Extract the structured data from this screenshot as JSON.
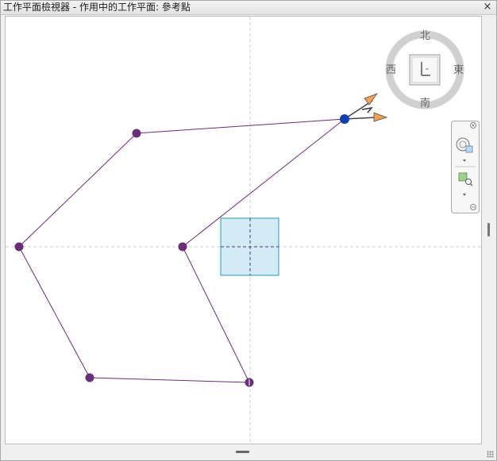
{
  "window": {
    "title": "工作平面檢視器 - 作用中的工作平面: 參考點",
    "close_glyph": "×"
  },
  "viewcube": {
    "north": "北",
    "south": "南",
    "east": "東",
    "west": "西"
  },
  "colors": {
    "curve": "#6a2d7a",
    "point": "#6a2d7a",
    "selected_point": "#1040b0",
    "workplane_fill": "#d3ebf5",
    "workplane_stroke": "#2a9bb0",
    "axis_arrow": "#f0a050"
  },
  "icons": {
    "close": "close-icon",
    "viewcube_home": "viewcube-icon",
    "orbit": "orbit-icon",
    "zoom": "zoom-region-icon"
  }
}
